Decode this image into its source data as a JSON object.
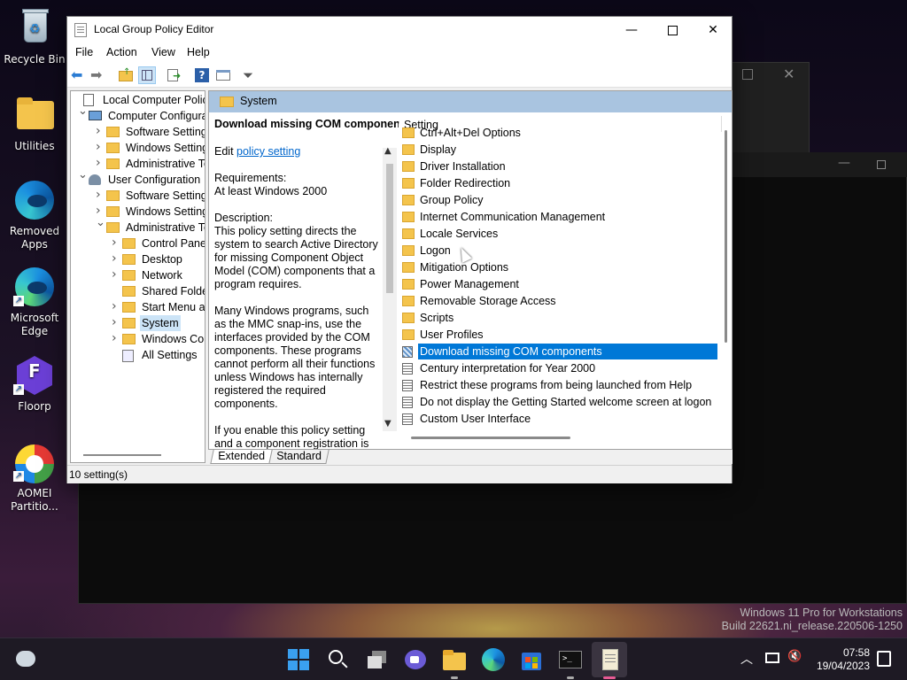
{
  "desktop": {
    "icons": [
      {
        "label": "Recycle Bin",
        "icon": "recycle-bin-icon"
      },
      {
        "label": "Utilities",
        "icon": "folder-icon"
      },
      {
        "label": "Removed Apps",
        "icon": "edge-icon"
      },
      {
        "label": "Microsoft Edge",
        "icon": "edge-icon"
      },
      {
        "label": "Floorp",
        "icon": "floorp-icon"
      },
      {
        "label": "AOMEI Partitio...",
        "icon": "aomei-icon"
      }
    ],
    "watermark": {
      "line1": "Windows 11 Pro for Workstations",
      "line2": "Build 22621.ni_release.220506-1250"
    }
  },
  "window": {
    "title": "Local Group Policy Editor",
    "menu": [
      "File",
      "Action",
      "View",
      "Help"
    ],
    "tree": [
      {
        "label": "Local Computer Policy",
        "depth": 0,
        "expand": "",
        "icon": "policy"
      },
      {
        "label": "Computer Configura",
        "depth": 1,
        "expand": "v",
        "icon": "computer"
      },
      {
        "label": "Software Settings",
        "depth": 2,
        "expand": ">",
        "icon": "folder"
      },
      {
        "label": "Windows Setting",
        "depth": 2,
        "expand": ">",
        "icon": "folder"
      },
      {
        "label": "Administrative Te",
        "depth": 2,
        "expand": ">",
        "icon": "folder"
      },
      {
        "label": "User Configuration",
        "depth": 1,
        "expand": "v",
        "icon": "user"
      },
      {
        "label": "Software Settings",
        "depth": 2,
        "expand": ">",
        "icon": "folder"
      },
      {
        "label": "Windows Setting",
        "depth": 2,
        "expand": ">",
        "icon": "folder"
      },
      {
        "label": "Administrative Te",
        "depth": 2,
        "expand": "v",
        "icon": "folder"
      },
      {
        "label": "Control Panel",
        "depth": 3,
        "expand": ">",
        "icon": "folder"
      },
      {
        "label": "Desktop",
        "depth": 3,
        "expand": ">",
        "icon": "folder"
      },
      {
        "label": "Network",
        "depth": 3,
        "expand": ">",
        "icon": "folder"
      },
      {
        "label": "Shared Folder",
        "depth": 3,
        "expand": "",
        "icon": "folder"
      },
      {
        "label": "Start Menu ar",
        "depth": 3,
        "expand": ">",
        "icon": "folder"
      },
      {
        "label": "System",
        "depth": 3,
        "expand": ">",
        "icon": "folder",
        "selected": true
      },
      {
        "label": "Windows Cor",
        "depth": 3,
        "expand": ">",
        "icon": "folder"
      },
      {
        "label": "All Settings",
        "depth": 3,
        "expand": "",
        "icon": "settings"
      }
    ],
    "right_header": "System",
    "description": {
      "title": "Download missing COM components",
      "edit_prefix": "Edit ",
      "edit_link": "policy setting",
      "requirements_label": "Requirements:",
      "requirements": "At least Windows 2000",
      "description_label": "Description:",
      "p1": "This policy setting directs the system to search Active Directory for missing Component Object Model (COM) components that a program requires.",
      "p2": "Many Windows programs, such as the MMC snap-ins, use the interfaces provided by the COM components. These programs cannot perform all their functions unless Windows has internally registered the required components.",
      "p3": "If you enable this policy setting and a component registration is"
    },
    "list_header": "Setting",
    "settings": [
      {
        "label": "Ctrl+Alt+Del Options",
        "type": "folder"
      },
      {
        "label": "Display",
        "type": "folder"
      },
      {
        "label": "Driver Installation",
        "type": "folder"
      },
      {
        "label": "Folder Redirection",
        "type": "folder"
      },
      {
        "label": "Group Policy",
        "type": "folder"
      },
      {
        "label": "Internet Communication Management",
        "type": "folder"
      },
      {
        "label": "Locale Services",
        "type": "folder"
      },
      {
        "label": "Logon",
        "type": "folder"
      },
      {
        "label": "Mitigation Options",
        "type": "folder"
      },
      {
        "label": "Power Management",
        "type": "folder"
      },
      {
        "label": "Removable Storage Access",
        "type": "folder"
      },
      {
        "label": "Scripts",
        "type": "folder"
      },
      {
        "label": "User Profiles",
        "type": "folder"
      },
      {
        "label": "Download missing COM components",
        "type": "policy",
        "selected": true
      },
      {
        "label": "Century interpretation for Year 2000",
        "type": "policy"
      },
      {
        "label": "Restrict these programs from being launched from Help",
        "type": "policy"
      },
      {
        "label": "Do not display the Getting Started welcome screen at logon",
        "type": "policy"
      },
      {
        "label": "Custom User Interface",
        "type": "policy"
      }
    ],
    "tabs": [
      "Extended",
      "Standard"
    ],
    "status": "10 setting(s)"
  },
  "taskbar": {
    "apps": [
      "start-icon",
      "search-icon",
      "task-view-icon",
      "chat-icon",
      "file-explorer-icon",
      "edge-icon",
      "store-icon",
      "terminal-icon",
      "notepad-icon"
    ],
    "time": "07:58",
    "date": "19/04/2023"
  },
  "colors": {
    "selection": "#0078d7",
    "accent": "#005fb8",
    "folder": "#f4c44c"
  }
}
